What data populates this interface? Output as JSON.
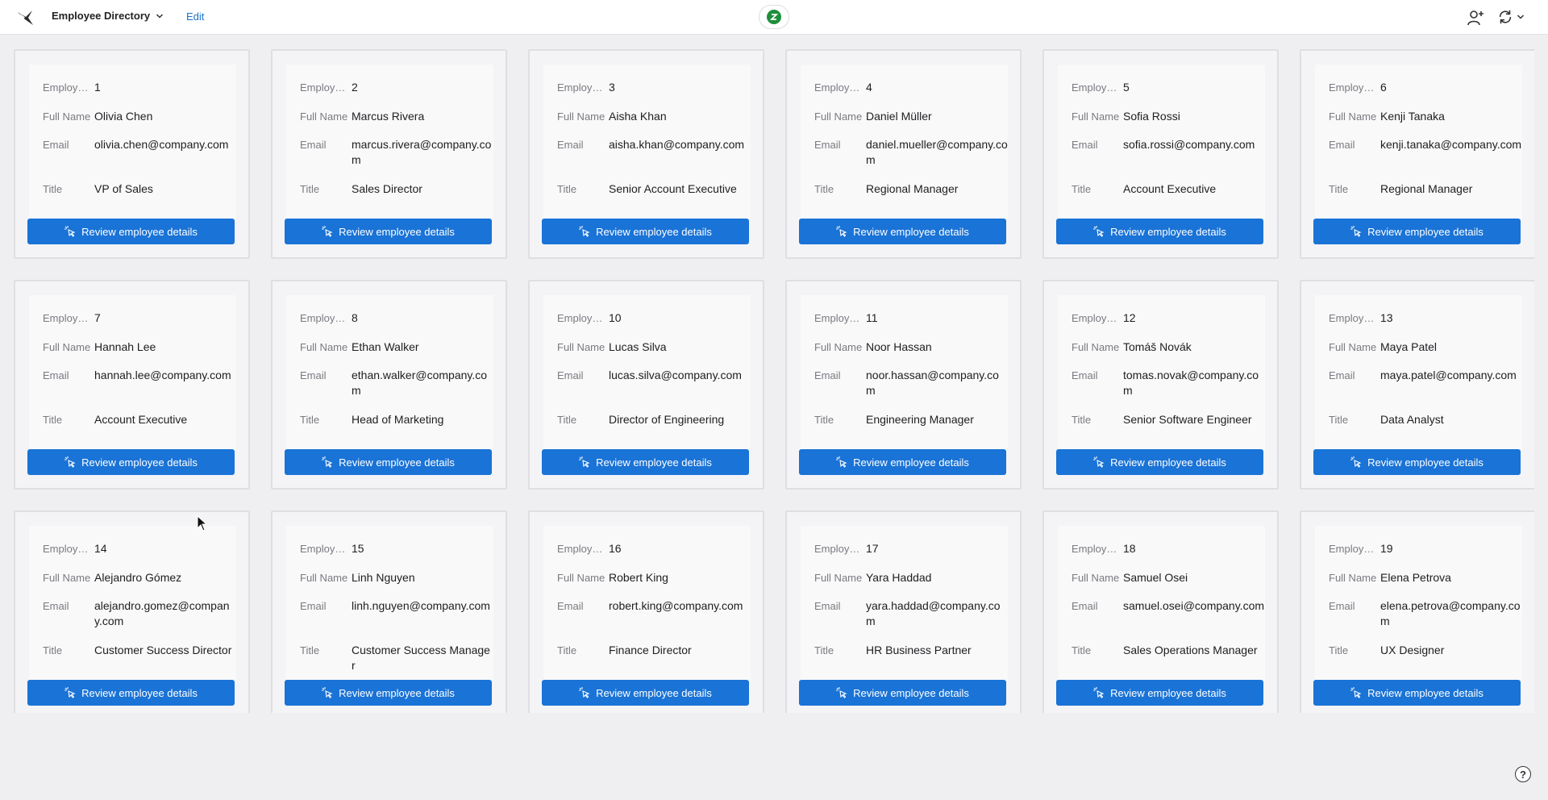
{
  "header": {
    "app_title": "Employee Directory",
    "edit_label": "Edit"
  },
  "labels": {
    "id": "Employee ID",
    "name": "Full Name",
    "email": "Email",
    "title": "Title",
    "button": "Review employee details"
  },
  "help": "?",
  "colors": {
    "accent": "#1a73d6",
    "badge": "#1f8f3a",
    "background": "#efeff1"
  },
  "employees": [
    {
      "id": "1",
      "name": "Olivia Chen",
      "email": "olivia.chen@company.com",
      "title": "VP of Sales"
    },
    {
      "id": "2",
      "name": "Marcus Rivera",
      "email": "marcus.rivera@company.com",
      "title": "Sales Director"
    },
    {
      "id": "3",
      "name": "Aisha Khan",
      "email": "aisha.khan@company.com",
      "title": "Senior Account Executive"
    },
    {
      "id": "4",
      "name": "Daniel Müller",
      "email": "daniel.mueller@company.com",
      "title": "Regional Manager"
    },
    {
      "id": "5",
      "name": "Sofia Rossi",
      "email": "sofia.rossi@company.com",
      "title": "Account Executive"
    },
    {
      "id": "6",
      "name": "Kenji Tanaka",
      "email": "kenji.tanaka@company.com",
      "title": "Regional Manager"
    },
    {
      "id": "7",
      "name": "Hannah Lee",
      "email": "hannah.lee@company.com",
      "title": "Account Executive"
    },
    {
      "id": "8",
      "name": "Ethan Walker",
      "email": "ethan.walker@company.com",
      "title": "Head of Marketing"
    },
    {
      "id": "10",
      "name": "Lucas Silva",
      "email": "lucas.silva@company.com",
      "title": "Director of Engineering"
    },
    {
      "id": "11",
      "name": "Noor Hassan",
      "email": "noor.hassan@company.com",
      "title": "Engineering Manager"
    },
    {
      "id": "12",
      "name": "Tomáš Novák",
      "email": "tomas.novak@company.com",
      "title": "Senior Software Engineer"
    },
    {
      "id": "13",
      "name": "Maya Patel",
      "email": "maya.patel@company.com",
      "title": "Data Analyst"
    },
    {
      "id": "14",
      "name": "Alejandro Gómez",
      "email": "alejandro.gomez@company.com",
      "title": "Customer Success Director"
    },
    {
      "id": "15",
      "name": "Linh Nguyen",
      "email": "linh.nguyen@company.com",
      "title": "Customer Success Manager"
    },
    {
      "id": "16",
      "name": "Robert King",
      "email": "robert.king@company.com",
      "title": "Finance Director"
    },
    {
      "id": "17",
      "name": "Yara Haddad",
      "email": "yara.haddad@company.com",
      "title": "HR Business Partner"
    },
    {
      "id": "18",
      "name": "Samuel Osei",
      "email": "samuel.osei@company.com",
      "title": "Sales Operations Manager"
    },
    {
      "id": "19",
      "name": "Elena Petrova",
      "email": "elena.petrova@company.com",
      "title": "UX Designer"
    }
  ]
}
